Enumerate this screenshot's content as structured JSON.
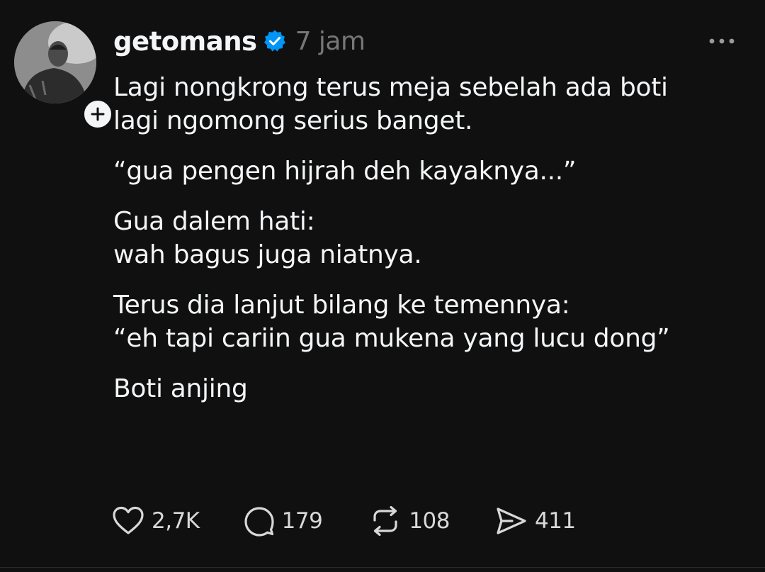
{
  "post": {
    "username": "getomans",
    "time": "7 jam",
    "verified": true,
    "paragraphs": [
      "Lagi nongkrong terus meja sebelah ada boti\nlagi ngomong serius banget.",
      "“gua pengen hijrah deh kayaknya...”",
      "Gua dalem hati:\nwah bagus juga niatnya.",
      "Terus dia lanjut bilang ke temennya:\n“eh tapi cariin gua mukena yang lucu dong”",
      "Boti anjing"
    ],
    "actions": {
      "likes": "2,7K",
      "replies": "179",
      "reposts": "108",
      "shares": "411"
    }
  },
  "icons": {
    "verified": "verified-badge-icon",
    "follow": "plus-icon",
    "more": "more-horizontal-icon",
    "like": "heart-icon",
    "reply": "comment-icon",
    "repost": "repost-icon",
    "share": "send-icon"
  },
  "colors": {
    "background": "#101010",
    "text": "#f3f5f7",
    "muted": "#777777",
    "verified": "#0095f6"
  }
}
